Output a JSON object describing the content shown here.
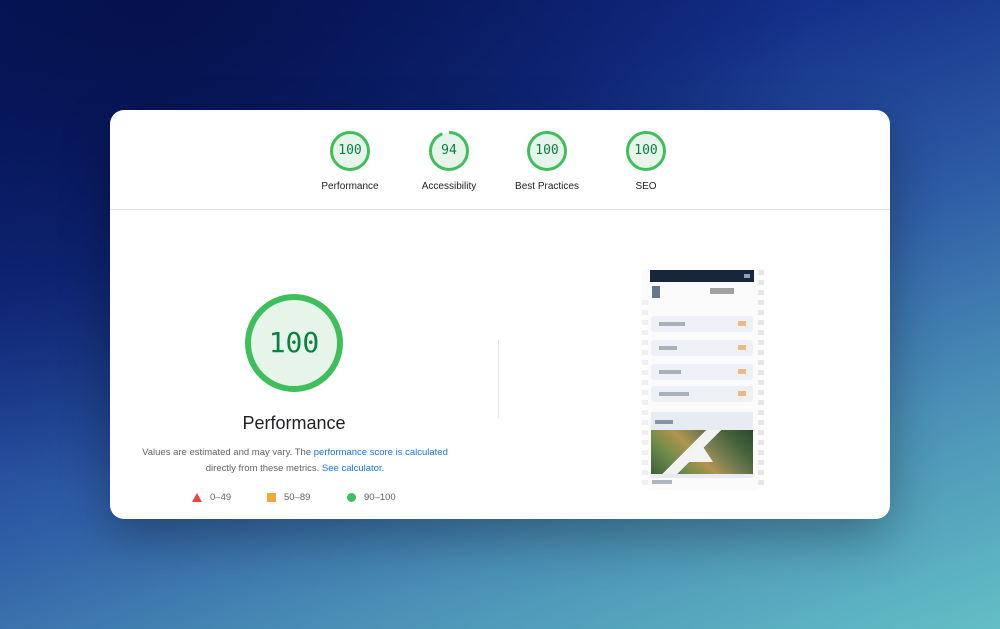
{
  "scores": [
    {
      "label": "Performance",
      "value": "100",
      "fraction": 1.0
    },
    {
      "label": "Accessibility",
      "value": "94",
      "fraction": 0.94
    },
    {
      "label": "Best Practices",
      "value": "100",
      "fraction": 1.0
    },
    {
      "label": "SEO",
      "value": "100",
      "fraction": 1.0
    }
  ],
  "main": {
    "score": "100",
    "fraction": 1.0,
    "title": "Performance",
    "desc_text1": "Values are estimated and may vary. The ",
    "desc_link1": "performance score is calculated",
    "desc_text2": "directly from these metrics. ",
    "desc_link2": "See calculator",
    "desc_text3": "."
  },
  "legend": [
    {
      "range": "0–49",
      "shape": "triangle",
      "color": "#e8453c"
    },
    {
      "range": "50–89",
      "shape": "square",
      "color": "#f4a93b"
    },
    {
      "range": "90–100",
      "shape": "circle",
      "color": "#3fbf5c"
    }
  ],
  "colors": {
    "pass": "#0b8043",
    "pass_ring": "#3fbf5c",
    "pass_fill": "#e6f4ea",
    "link": "#1a73e8"
  }
}
